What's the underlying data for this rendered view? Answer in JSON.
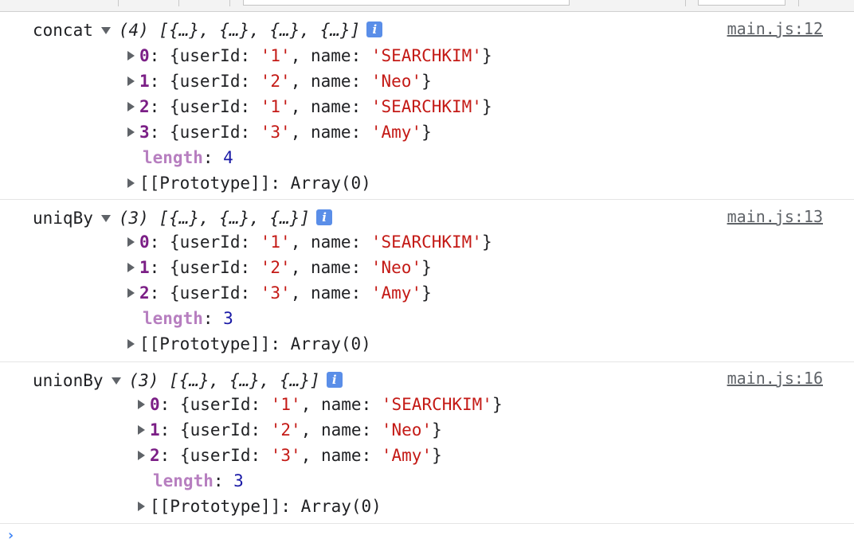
{
  "toolbar": {},
  "groups": [
    {
      "label": "concat",
      "summary": "(4) [{…}, {…}, {…}, {…}]",
      "info": "i",
      "source": "main.js:12",
      "items": [
        {
          "index": "0",
          "userId": "'1'",
          "name": "'SEARCHKIM'"
        },
        {
          "index": "1",
          "userId": "'2'",
          "name": "'Neo'"
        },
        {
          "index": "2",
          "userId": "'1'",
          "name": "'SEARCHKIM'"
        },
        {
          "index": "3",
          "userId": "'3'",
          "name": "'Amy'"
        }
      ],
      "length_key": "length",
      "length_value": "4",
      "prototype_key": "[[Prototype]]",
      "prototype_value": "Array(0)"
    },
    {
      "label": "uniqBy",
      "summary": "(3) [{…}, {…}, {…}]",
      "info": "i",
      "source": "main.js:13",
      "items": [
        {
          "index": "0",
          "userId": "'1'",
          "name": "'SEARCHKIM'"
        },
        {
          "index": "1",
          "userId": "'2'",
          "name": "'Neo'"
        },
        {
          "index": "2",
          "userId": "'3'",
          "name": "'Amy'"
        }
      ],
      "length_key": "length",
      "length_value": "3",
      "prototype_key": "[[Prototype]]",
      "prototype_value": "Array(0)"
    },
    {
      "label": "unionBy",
      "summary": "(3) [{…}, {…}, {…}]",
      "info": "i",
      "source": "main.js:16",
      "items": [
        {
          "index": "0",
          "userId": "'1'",
          "name": "'SEARCHKIM'"
        },
        {
          "index": "1",
          "userId": "'2'",
          "name": "'Neo'"
        },
        {
          "index": "2",
          "userId": "'3'",
          "name": "'Amy'"
        }
      ],
      "length_key": "length",
      "length_value": "3",
      "prototype_key": "[[Prototype]]",
      "prototype_value": "Array(0)"
    }
  ],
  "syntax": {
    "prop_userId": "userId",
    "prop_name": "name",
    "colon": ": ",
    "open_brace": "{",
    "close_brace": "}",
    "comma": ", "
  },
  "prompt_symbol": "›",
  "colors": {
    "index": "#7b1f86",
    "string": "#c41a16",
    "number": "#1a1aa6",
    "dim_key": "#b77fc0",
    "info_badge": "#5a8ee8",
    "prompt": "#3b82f6"
  }
}
